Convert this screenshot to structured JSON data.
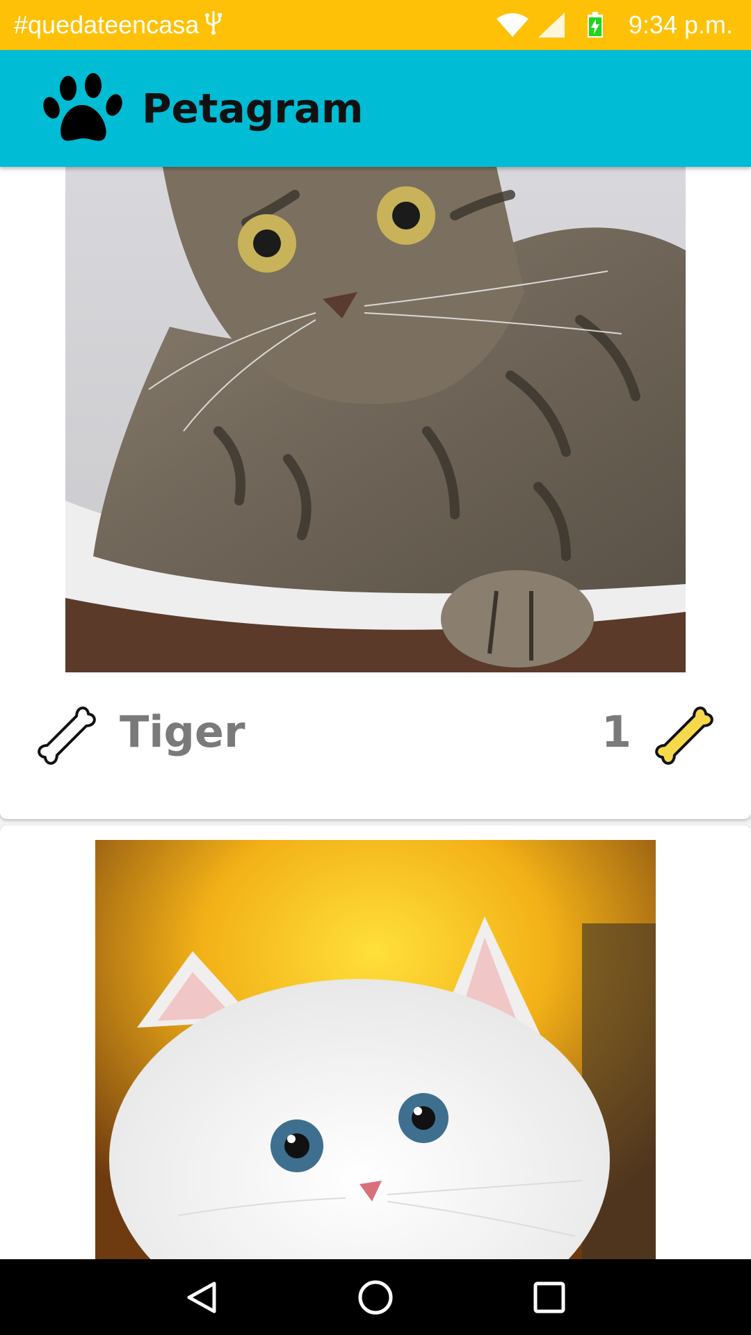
{
  "status_bar": {
    "notification_text": "#quedateencasa",
    "usb_icon": "usb-icon",
    "time": "9:34 p.m.",
    "icons": [
      "wifi-icon",
      "signal-icon",
      "battery-charging-icon"
    ]
  },
  "app_bar": {
    "title": "Petagram",
    "logo_icon": "paw-icon",
    "background": "#00bcd4"
  },
  "feed": {
    "posts": [
      {
        "name": "Tiger",
        "likes": "1",
        "photo": "tabby-cat-photo",
        "rate_icon": "bone-outline-icon",
        "like_icon": "bone-yellow-icon"
      },
      {
        "photo": "white-persian-kitten-photo"
      }
    ]
  },
  "nav_bar": {
    "buttons": [
      "back-icon",
      "home-icon",
      "recents-icon"
    ]
  },
  "colors": {
    "status_bar": "#ffc107",
    "accent_bone": "#f5d94a",
    "text_muted": "#7a7a7a"
  }
}
